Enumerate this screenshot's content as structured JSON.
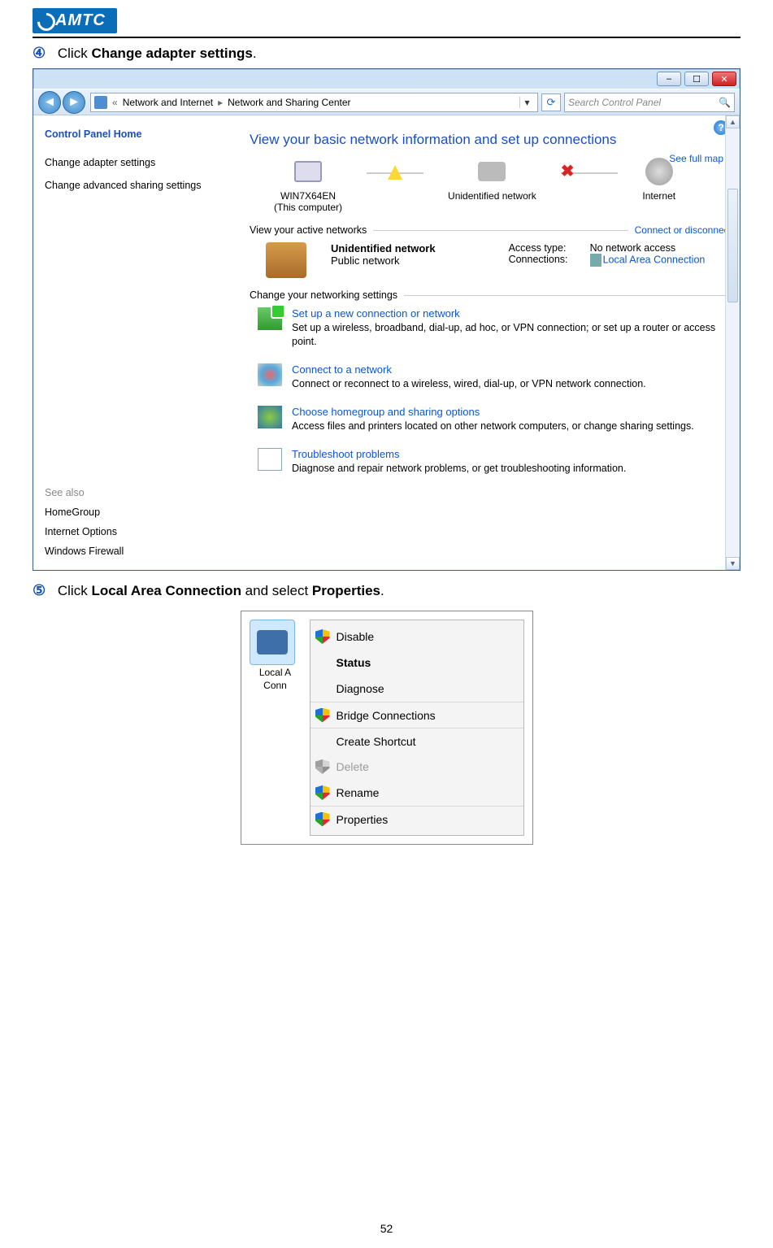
{
  "logo_text": "AMTC",
  "page_number": "52",
  "step4": {
    "num": "④",
    "prefix": "Click ",
    "bold": "Change adapter settings",
    "suffix": "."
  },
  "step5": {
    "num": "⑤",
    "prefix": "Click ",
    "bold1": "Local Area Connection",
    "mid": " and select ",
    "bold2": "Properties",
    "suffix": "."
  },
  "nav": {
    "bc_sep1": "«",
    "bc_item1": "Network and Internet",
    "bc_arrow": "▸",
    "bc_item2": "Network and Sharing Center",
    "bc_drop": "▾",
    "refresh": "⟳",
    "search_placeholder": "Search Control Panel",
    "search_icon": "🔍"
  },
  "sidebar": {
    "cp_home": "Control Panel Home",
    "change_adapter": "Change adapter settings",
    "change_sharing": "Change advanced sharing settings",
    "see_also": "See also",
    "homegroup": "HomeGroup",
    "inet_opts": "Internet Options",
    "firewall": "Windows Firewall"
  },
  "main": {
    "help": "?",
    "heading": "View your basic network information and set up connections",
    "see_map": "See full map",
    "node1": "WIN7X64EN",
    "node1_sub": "(This computer)",
    "node2": "Unidentified network",
    "node3": "Internet",
    "view_active": "View your active networks",
    "connect_disconnect": "Connect or disconnect",
    "unid_net": "Unidentified network",
    "pub_net": "Public network",
    "access_label": "Access type:",
    "access_val": "No network access",
    "conn_label": "Connections:",
    "conn_val": "Local Area Connection",
    "change_settings": "Change your networking settings",
    "ns1_title": "Set up a new connection or network",
    "ns1_desc": "Set up a wireless, broadband, dial-up, ad hoc, or VPN connection; or set up a router or access point.",
    "ns2_title": "Connect to a network",
    "ns2_desc": "Connect or reconnect to a wireless, wired, dial-up, or VPN network connection.",
    "ns3_title": "Choose homegroup and sharing options",
    "ns3_desc": "Access files and printers located on other network computers, or change sharing settings.",
    "ns4_title": "Troubleshoot problems",
    "ns4_desc": "Diagnose and repair network problems, or get troubleshooting information."
  },
  "ctx": {
    "sel_label_1": "Local A",
    "sel_label_2": "Conn",
    "disable": "Disable",
    "status": "Status",
    "diagnose": "Diagnose",
    "bridge": "Bridge Connections",
    "shortcut": "Create Shortcut",
    "delete": "Delete",
    "rename": "Rename",
    "properties": "Properties"
  },
  "winbuttons": {
    "min": "–",
    "max": "☐",
    "close": "✕"
  },
  "scroll": {
    "up": "▲",
    "down": "▼"
  }
}
